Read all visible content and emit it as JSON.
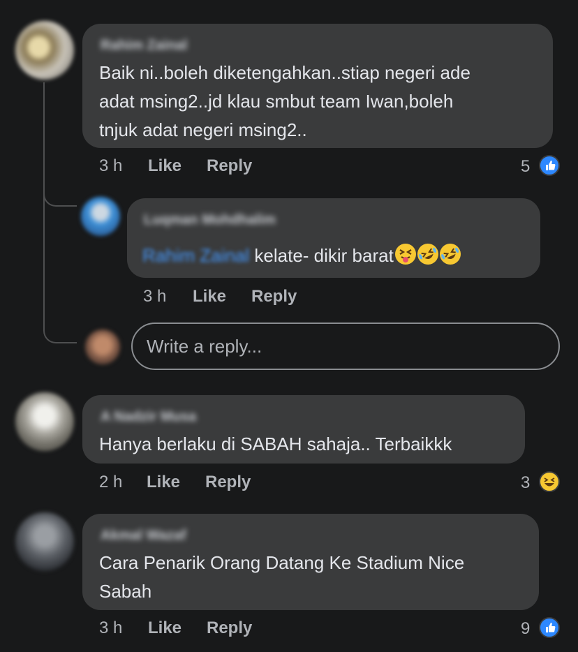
{
  "comments": [
    {
      "author": "Rahim Zainal",
      "text": "Baik ni..boleh diketengahkan..stiap negeri ade\nadat msing2..jd klau smbut team Iwan,boleh\ntnjuk adat negeri msing2..",
      "time": "3 h",
      "like_label": "Like",
      "reply_label": "Reply",
      "reaction_count": "5",
      "reaction_icon": "like-icon"
    },
    {
      "author": "A Nadzir Musa",
      "text": "Hanya berlaku di SABAH sahaja.. Terbaikkk",
      "time": "2 h",
      "like_label": "Like",
      "reply_label": "Reply",
      "reaction_count": "3",
      "reaction_icon": "haha-icon"
    },
    {
      "author": "Akmal Wazaf",
      "text": "Cara Penarik Orang Datang Ke Stadium Nice\nSabah",
      "time": "3 h",
      "like_label": "Like",
      "reply_label": "Reply",
      "reaction_count": "9",
      "reaction_icon": "like-icon"
    }
  ],
  "reply": {
    "author": "Luqman Mohdhalim",
    "mention": "Rahim Zainal",
    "text": " kelate- dikir barat",
    "emojis": [
      "squinting-tongue-emoji",
      "rofl-emoji",
      "rofl-emoji"
    ],
    "time": "3 h",
    "like_label": "Like",
    "reply_label": "Reply"
  },
  "reply_box": {
    "placeholder": "Write a reply..."
  },
  "colors": {
    "background": "#18191a",
    "bubble": "#3a3b3c",
    "text": "#e4e6eb",
    "meta": "#b0b3b8",
    "like_blue": "#2d88ff",
    "haha_yellow": "#f7c832"
  }
}
